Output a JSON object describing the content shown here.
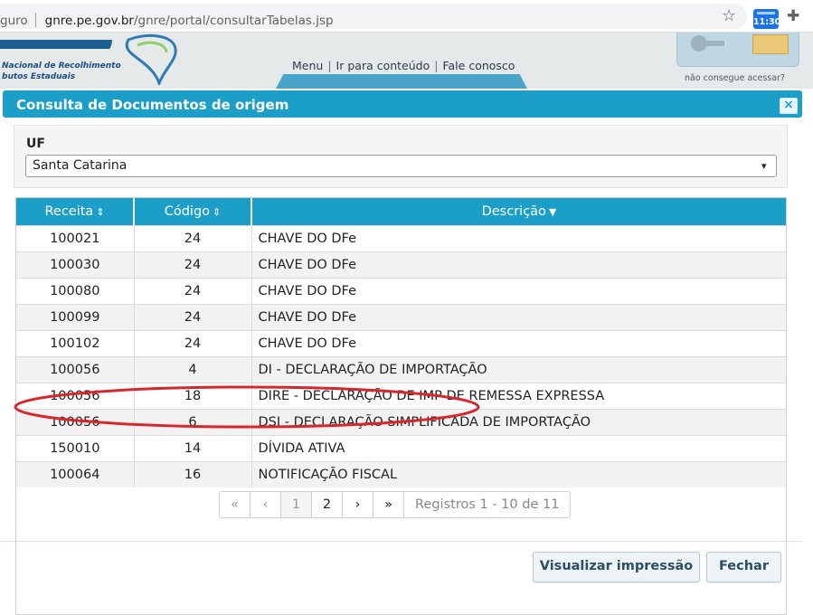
{
  "browser": {
    "url_prefix": "guro",
    "url_host": "gnre.pe.gov.br",
    "url_path": "/gnre/portal/consultarTabelas.jsp",
    "clock_badge": "11:30"
  },
  "header": {
    "logo_line1": "Nacional de Recolhimento",
    "logo_line2": "butos Estaduais",
    "nav_menu": "Menu",
    "nav_content": "Ir para conteúdo",
    "nav_contact": "Fale conosco",
    "access_text": "não consegue acessar?"
  },
  "dialog": {
    "title": "Consulta de Documentos de origem",
    "close_symbol": "×",
    "uf_label": "UF",
    "uf_value": "Santa Catarina",
    "columns": [
      "Receita",
      "Código",
      "Descrição"
    ],
    "sort_both": "⇕",
    "sort_desc": "▼",
    "rows": [
      {
        "receita": "100021",
        "codigo": "24",
        "descricao": "CHAVE DO DFe"
      },
      {
        "receita": "100030",
        "codigo": "24",
        "descricao": "CHAVE DO DFe"
      },
      {
        "receita": "100080",
        "codigo": "24",
        "descricao": "CHAVE DO DFe"
      },
      {
        "receita": "100099",
        "codigo": "24",
        "descricao": "CHAVE DO DFe"
      },
      {
        "receita": "100102",
        "codigo": "24",
        "descricao": "CHAVE DO DFe"
      },
      {
        "receita": "100056",
        "codigo": "4",
        "descricao": "DI - DECLARAÇÃO DE IMPORTAÇÃO"
      },
      {
        "receita": "100056",
        "codigo": "18",
        "descricao": "DIRE - DECLARAÇÃO DE IMP DE REMESSA EXPRESSA"
      },
      {
        "receita": "100056",
        "codigo": "6",
        "descricao": "DSI - DECLARAÇÃO SIMPLIFICADA DE IMPORTAÇÃO"
      },
      {
        "receita": "150010",
        "codigo": "14",
        "descricao": "DÍVIDA ATIVA"
      },
      {
        "receita": "100064",
        "codigo": "16",
        "descricao": "NOTIFICAÇÃO FISCAL"
      }
    ],
    "pager": {
      "first": "«",
      "prev": "‹",
      "page1": "1",
      "page2": "2",
      "next": "›",
      "last": "»",
      "info": "Registros 1 - 10 de 11"
    },
    "print_button": "Visualizar impressão",
    "close_button": "Fechar"
  },
  "colors": {
    "accent": "#1b9fc9",
    "highlight_ring": "#d9262a"
  }
}
